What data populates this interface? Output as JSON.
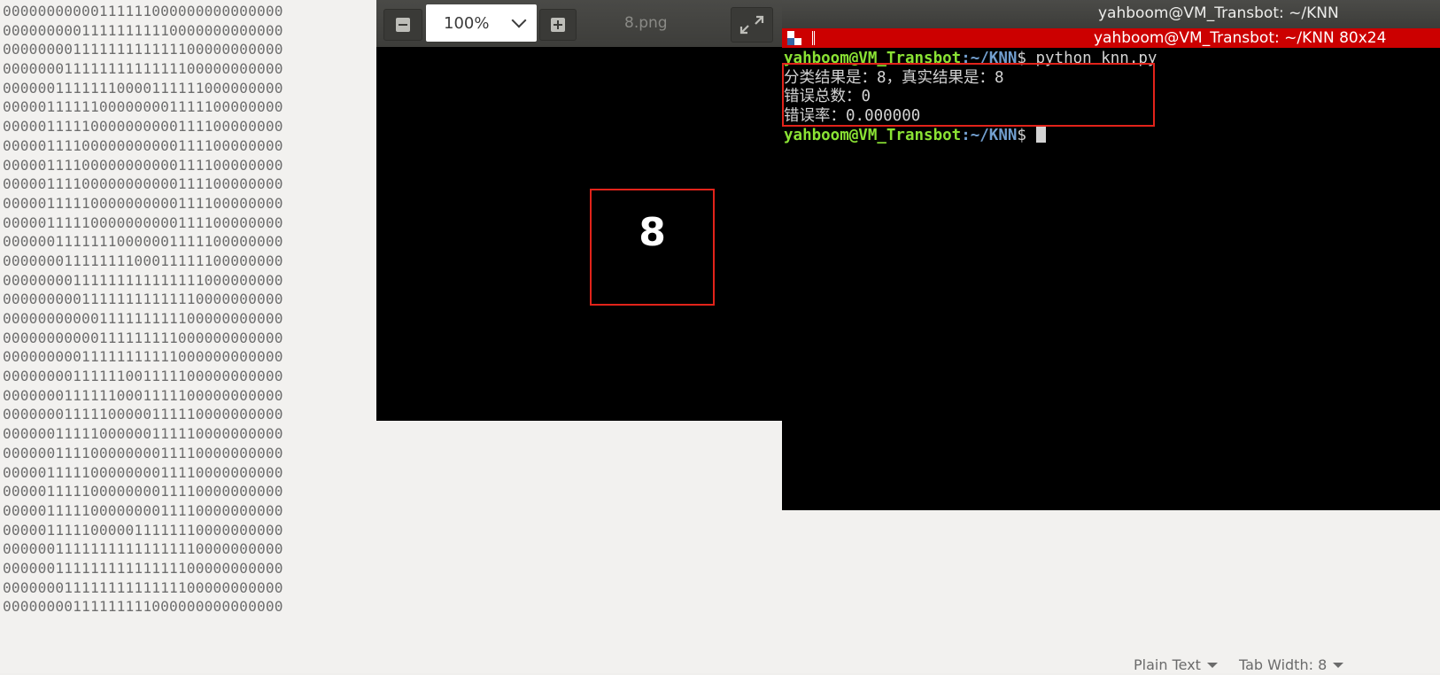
{
  "editor": {
    "matrix_rows": [
      "00000000000111111000000000000000",
      "00000000011111111110000000000000",
      "00000000111111111111100000000000",
      "00000001111111111111100000000000",
      "00000011111110000111111000000000",
      "00000111111000000001111100000000",
      "00000111110000000000111100000000",
      "00000111100000000000111100000000",
      "00000111100000000000111100000000",
      "00000111100000000000111100000000",
      "00000111110000000000111100000000",
      "00000111110000000000111100000000",
      "00000011111110000001111100000000",
      "00000001111111100011111100000000",
      "00000000111111111111111000000000",
      "00000000011111111111110000000000",
      "00000000000111111111100000000000",
      "00000000000111111111000000000000",
      "00000000011111111111000000000000",
      "00000000111111001111100000000000",
      "00000001111110001111100000000000",
      "00000001111100000111110000000000",
      "00000011111000000111110000000000",
      "00000011110000000011110000000000",
      "00000111110000000011110000000000",
      "00000111110000000011110000000000",
      "00000111110000000011110000000000",
      "00000111110000011111110000000000",
      "00000011111111111111110000000000",
      "00000011111111111111100000000000",
      "00000001111111111111100000000000",
      "00000000111111111000000000000000"
    ],
    "status": {
      "language": "Plain Text",
      "tab_width": "Tab Width: 8"
    }
  },
  "viewer": {
    "zoom": "100%",
    "filename": "8.png",
    "digit": "8"
  },
  "terminal": {
    "window_title": "yahboom@VM_Transbot: ~/KNN",
    "tab_title": "yahboom@VM_Transbot: ~/KNN 80x24",
    "prompt_user": "yahboom@VM_Transbot",
    "prompt_path": ":~/KNN",
    "prompt_symbol": "$",
    "command": " python knn.py",
    "output": [
      "分类结果是：8，真实结果是：8",
      "错误总数：0",
      "错误率：0.000000"
    ]
  },
  "colors": {
    "terminal_tab_red": "#cc0000",
    "prompt_green": "#8ae234",
    "prompt_blue": "#729fcf",
    "annotation_red": "#e2231a"
  }
}
